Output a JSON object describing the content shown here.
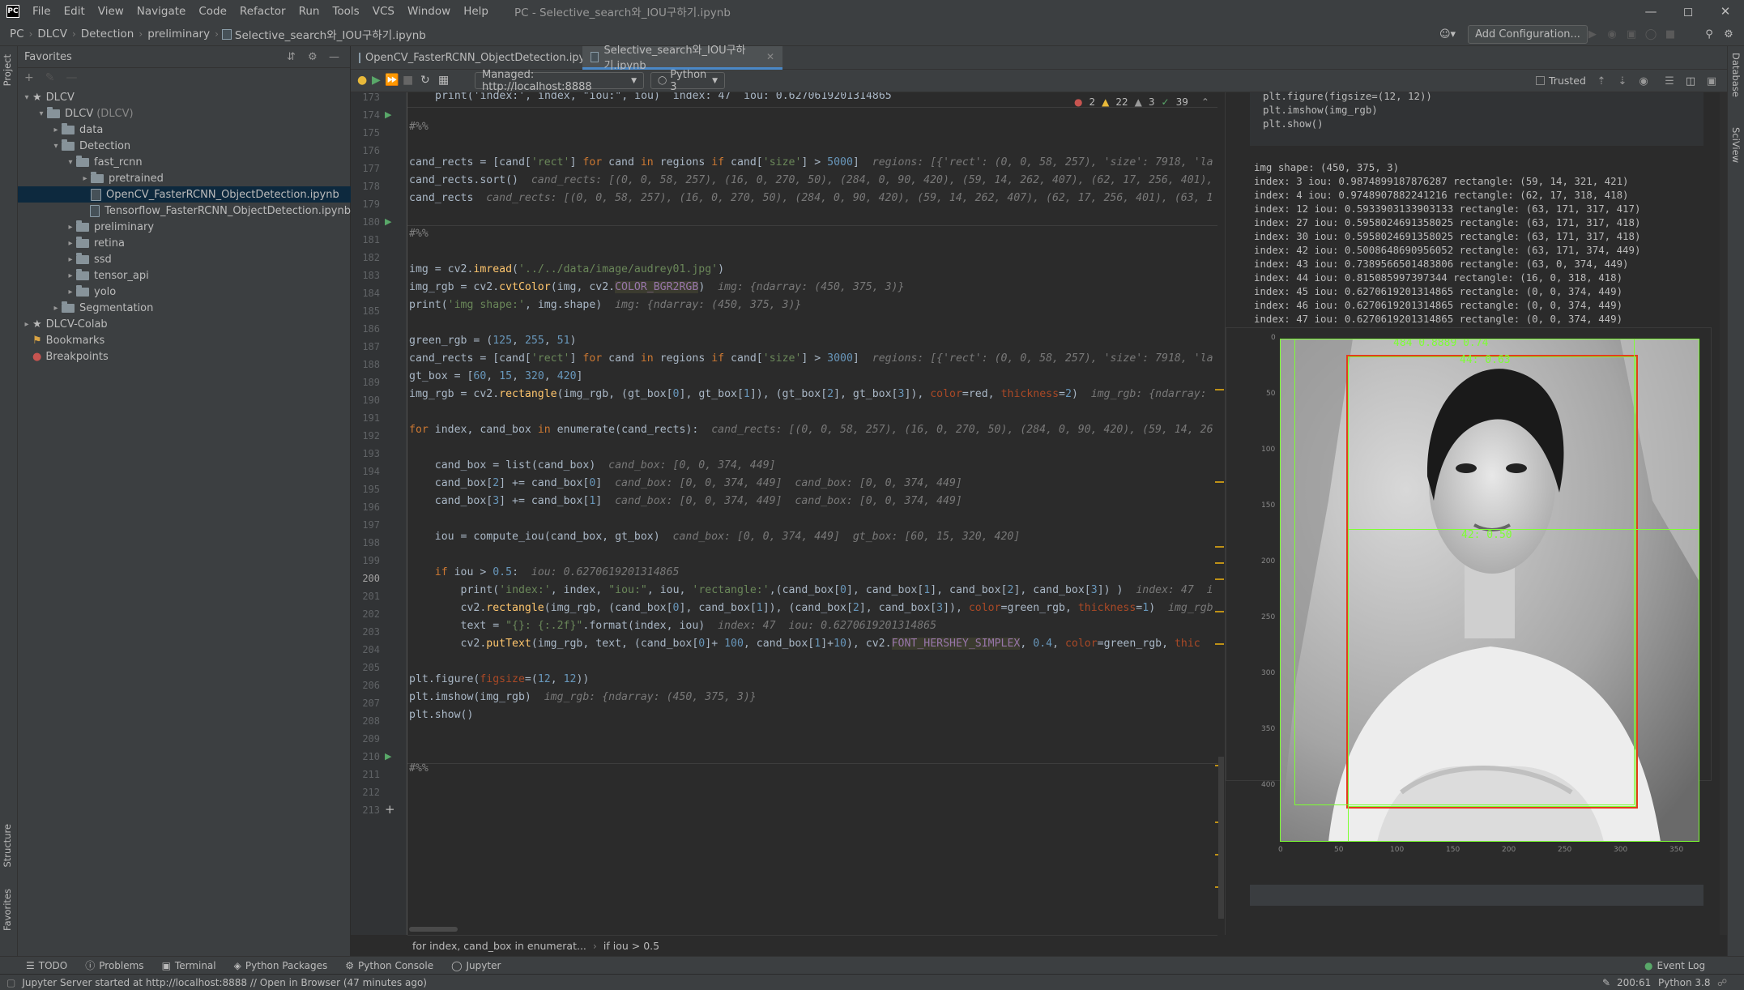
{
  "menubar": {
    "logo": "PC",
    "items": [
      "File",
      "Edit",
      "View",
      "Navigate",
      "Code",
      "Refactor",
      "Run",
      "Tools",
      "VCS",
      "Window",
      "Help"
    ],
    "window_title": "PC - Selective_search와_IOU구하기.ipynb"
  },
  "navbar": {
    "crumbs": [
      "PC",
      "DLCV",
      "Detection",
      "preliminary",
      "Selective_search와_IOU구하기.ipynb"
    ],
    "add_config": "Add Configuration..."
  },
  "left_strip": {
    "project": "Project",
    "structure": "Structure",
    "favorites": "Favorites"
  },
  "favorites": {
    "title": "Favorites",
    "tree": [
      {
        "label": "DLCV",
        "type": "star",
        "expanded": true
      },
      {
        "label": "DLCV",
        "suffix": "(DLCV)",
        "type": "folder",
        "expanded": true
      },
      {
        "label": "data",
        "type": "folder",
        "expanded": false
      },
      {
        "label": "Detection",
        "type": "folder",
        "expanded": true
      },
      {
        "label": "fast_rcnn",
        "type": "folder",
        "expanded": true
      },
      {
        "label": "pretrained",
        "type": "folder",
        "expanded": false
      },
      {
        "label": "OpenCV_FasterRCNN_ObjectDetection.ipynb",
        "type": "file",
        "selected": true
      },
      {
        "label": "Tensorflow_FasterRCNN_ObjectDetection.ipynb",
        "type": "file"
      },
      {
        "label": "preliminary",
        "type": "folder",
        "expanded": false
      },
      {
        "label": "retina",
        "type": "folder",
        "expanded": false
      },
      {
        "label": "ssd",
        "type": "folder",
        "expanded": false
      },
      {
        "label": "tensor_api",
        "type": "folder",
        "expanded": false
      },
      {
        "label": "yolo",
        "type": "folder",
        "expanded": false
      },
      {
        "label": "Segmentation",
        "type": "folder",
        "expanded": false
      },
      {
        "label": "DLCV-Colab",
        "type": "star",
        "expanded": false
      },
      {
        "label": "Bookmarks",
        "type": "bookmark"
      },
      {
        "label": "Breakpoints",
        "type": "breakpoint"
      }
    ]
  },
  "tabs": [
    {
      "label": "OpenCV_FasterRCNN_ObjectDetection.ipynb",
      "active": false
    },
    {
      "label": "Selective_search와_IOU구하기.ipynb",
      "active": true
    }
  ],
  "nbtoolbar": {
    "server": "Managed: http://localhost:8888",
    "kernel": "Python 3",
    "trusted": "Trusted"
  },
  "inspections": {
    "errors": "2",
    "warnings": "22",
    "weak": "3",
    "typos": "39"
  },
  "code": {
    "line_numbers": [
      "173",
      "174",
      "175",
      "176",
      "177",
      "178",
      "179",
      "180",
      "181",
      "182",
      "183",
      "184",
      "185",
      "186",
      "187",
      "188",
      "189",
      "190",
      "191",
      "192",
      "193",
      "194",
      "195",
      "196",
      "197",
      "198",
      "199",
      "200",
      "201",
      "202",
      "203",
      "204",
      "205",
      "206",
      "207",
      "208",
      "209",
      "210",
      "211",
      "212",
      "213"
    ],
    "top_partial": "print('index:', index, \"iou:\", iou)  index: 47  iou: 0.6270619201314865"
  },
  "output": {
    "prev_code": [
      "plt.figure(figsize=(12, 12))",
      "plt.imshow(img_rgb)",
      "plt.show()"
    ],
    "lines": [
      "img shape: (450, 375, 3)",
      "index: 3 iou: 0.9874899187876287 rectangle: (59, 14, 321, 421)",
      "index: 4 iou: 0.9748907882241216 rectangle: (62, 17, 318, 418)",
      "index: 12 iou: 0.5933903133903133 rectangle: (63, 171, 317, 417)",
      "index: 27 iou: 0.5958024691358025 rectangle: (63, 171, 317, 418)",
      "index: 30 iou: 0.5958024691358025 rectangle: (63, 171, 317, 418)",
      "index: 42 iou: 0.5008648690956052 rectangle: (63, 171, 374, 449)",
      "index: 43 iou: 0.7389566501483806 rectangle: (63, 0, 374, 449)",
      "index: 44 iou: 0.815085997397344 rectangle: (16, 0, 318, 418)",
      "index: 45 iou: 0.6270619201314865 rectangle: (0, 0, 374, 449)",
      "index: 46 iou: 0.6270619201314865 rectangle: (0, 0, 374, 449)",
      "index: 47 iou: 0.6270619201314865 rectangle: (0, 0, 374, 449)"
    ],
    "plot": {
      "y_ticks": [
        "0",
        "50",
        "100",
        "150",
        "200",
        "250",
        "300",
        "350",
        "400"
      ],
      "x_ticks": [
        "0",
        "50",
        "100",
        "150",
        "200",
        "250",
        "300",
        "350"
      ],
      "label_top": "484 0.8889 0.74",
      "label_mid": "44: 0.63",
      "label_low": "42: 0.50"
    }
  },
  "crumbbar": {
    "a": "for index, cand_box in enumerat...",
    "b": "if iou > 0.5"
  },
  "bottom_tabs": [
    "TODO",
    "Problems",
    "Terminal",
    "Python Packages",
    "Python Console",
    "Jupyter"
  ],
  "event_log": "Event Log",
  "status": {
    "message": "Jupyter Server started at http://localhost:8888 // Open in Browser (47 minutes ago)",
    "position": "200:61",
    "interpreter": "Python 3.8"
  },
  "right_strip": {
    "database": "Database",
    "sciview": "SciView"
  },
  "colors": {
    "accent": "#4a88c7",
    "bg": "#2b2b2b",
    "panel": "#3c3f41"
  }
}
